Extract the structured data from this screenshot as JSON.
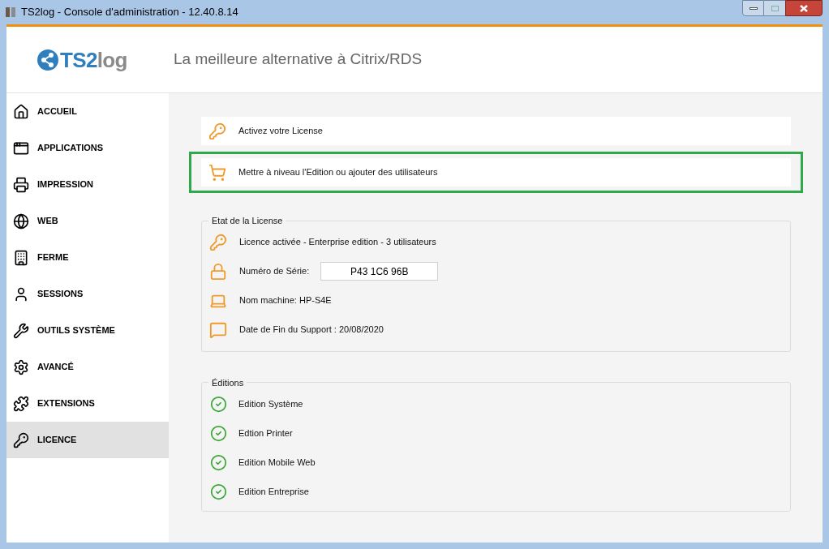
{
  "window": {
    "title": "TS2log - Console d'administration - 12.40.8.14"
  },
  "header": {
    "logo": {
      "primary": "TS2",
      "secondary": "log"
    },
    "tagline": "La meilleure alternative à Citrix/RDS"
  },
  "sidebar": {
    "items": [
      {
        "label": "ACCUEIL",
        "kind": "home",
        "selected": false
      },
      {
        "label": "APPLICATIONS",
        "kind": "window",
        "selected": false
      },
      {
        "label": "IMPRESSION",
        "kind": "printer",
        "selected": false
      },
      {
        "label": "WEB",
        "kind": "globe",
        "selected": false
      },
      {
        "label": "FERME",
        "kind": "building",
        "selected": false
      },
      {
        "label": "SESSIONS",
        "kind": "user",
        "selected": false
      },
      {
        "label": "OUTILS SYSTÈME",
        "kind": "wrench",
        "selected": false
      },
      {
        "label": "AVANCÉ",
        "kind": "gear",
        "selected": false
      },
      {
        "label": "EXTENSIONS",
        "kind": "puzzle",
        "selected": false
      },
      {
        "label": "LICENCE",
        "kind": "key",
        "selected": true
      }
    ]
  },
  "actions": [
    {
      "label": "Activez votre License",
      "kind": "key",
      "highlighted": false
    },
    {
      "label": "Mettre à niveau l'Edition ou ajouter des utilisateurs",
      "kind": "cart",
      "highlighted": true
    }
  ],
  "license_status": {
    "title": "Etat de la License",
    "rows": [
      {
        "kind": "key",
        "label": "Licence activée - Enterprise edition - 3 utilisateurs"
      },
      {
        "kind": "lock",
        "label": "Numéro de Série:",
        "value": "P43 1C6 96B"
      },
      {
        "kind": "laptop",
        "label": "Nom machine: HP-S4E"
      },
      {
        "kind": "chat",
        "label": "Date de Fin du Support : 20/08/2020"
      }
    ]
  },
  "editions": {
    "title": "Éditions",
    "items": [
      {
        "label": "Edition Système",
        "checked": true
      },
      {
        "label": "Edtion Printer",
        "checked": true
      },
      {
        "label": "Edition Mobile Web",
        "checked": true
      },
      {
        "label": "Edition Entreprise",
        "checked": true
      }
    ]
  }
}
